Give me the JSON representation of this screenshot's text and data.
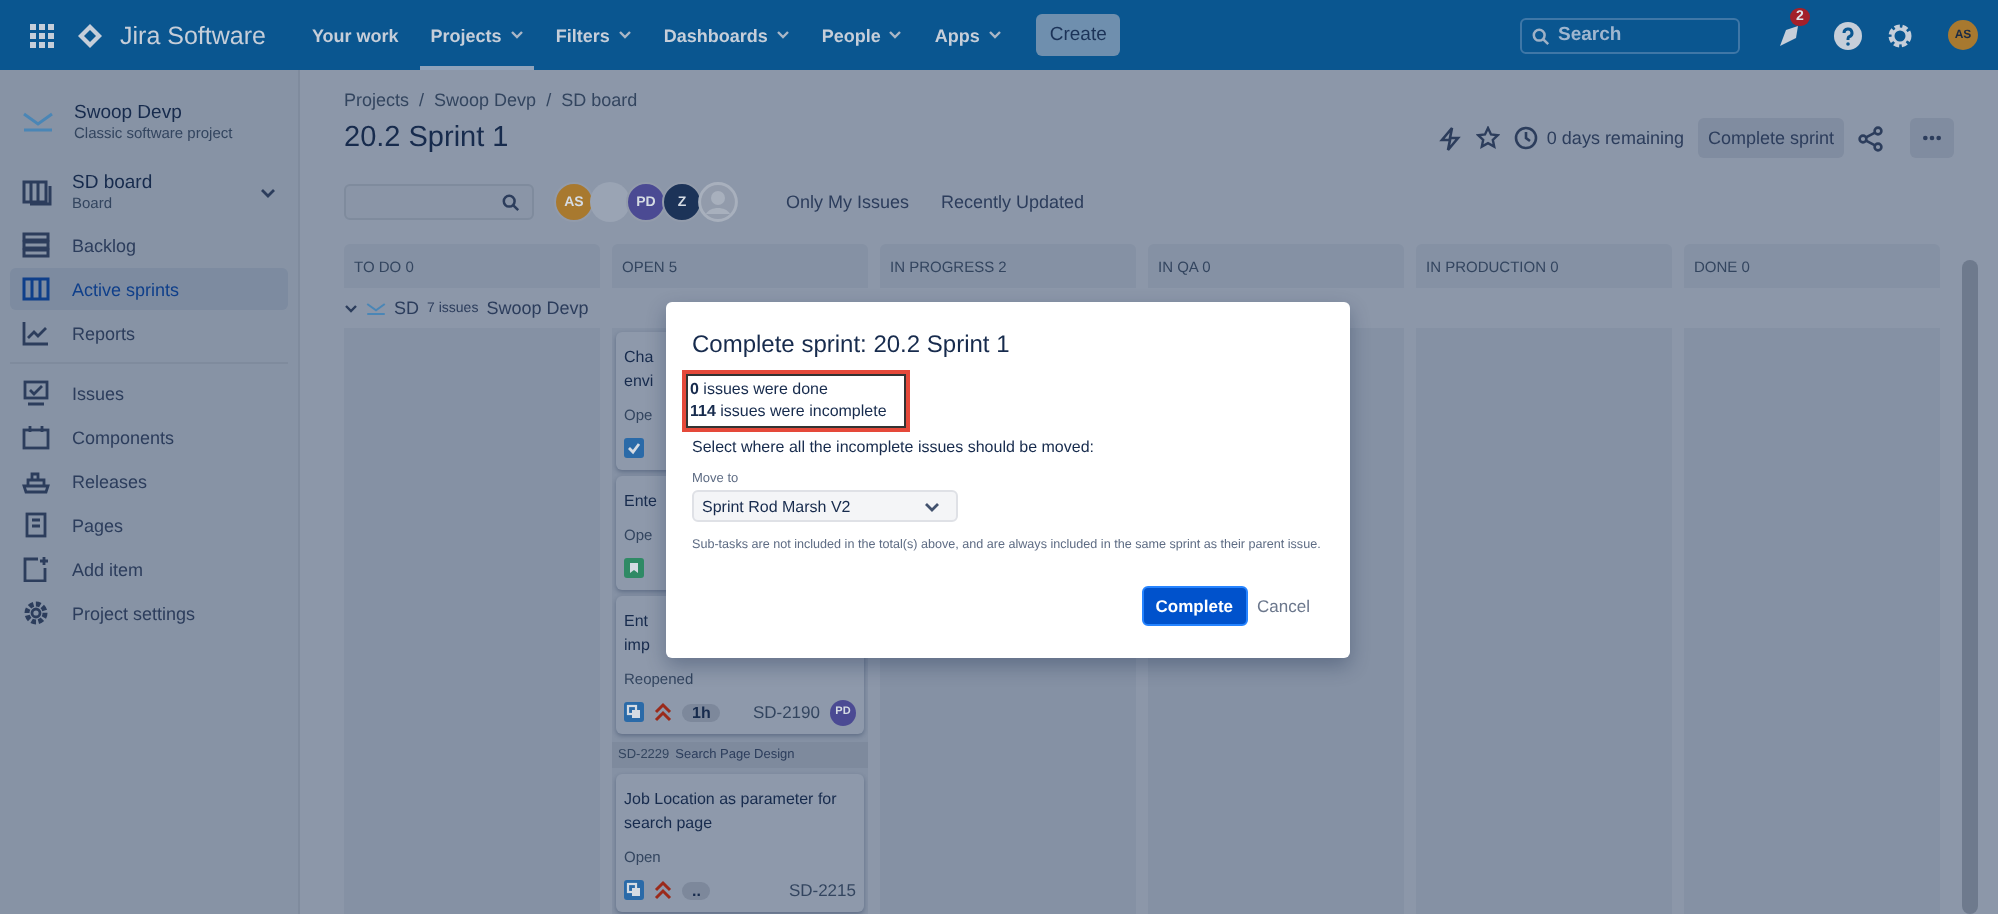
{
  "topnav": {
    "product": "Jira Software",
    "items": [
      {
        "label": "Your work",
        "dropdown": false,
        "selected": false
      },
      {
        "label": "Projects",
        "dropdown": true,
        "selected": true
      },
      {
        "label": "Filters",
        "dropdown": true,
        "selected": false
      },
      {
        "label": "Dashboards",
        "dropdown": true,
        "selected": false
      },
      {
        "label": "People",
        "dropdown": true,
        "selected": false
      },
      {
        "label": "Apps",
        "dropdown": true,
        "selected": false
      }
    ],
    "create": "Create",
    "search": {
      "placeholder": "Search"
    },
    "notification_count": "2",
    "avatar": "AS"
  },
  "sidebar": {
    "project": {
      "name": "Swoop Devp",
      "type": "Classic software project"
    },
    "board": {
      "name": "SD board",
      "type": "Board"
    },
    "items": [
      {
        "kind": "backlog",
        "label": "Backlog",
        "selected": false
      },
      {
        "kind": "sprints",
        "label": "Active sprints",
        "selected": true
      },
      {
        "kind": "reports",
        "label": "Reports",
        "selected": false
      }
    ],
    "more_items": [
      {
        "kind": "issues",
        "label": "Issues",
        "selected": false
      },
      {
        "kind": "components",
        "label": "Components",
        "selected": false
      },
      {
        "kind": "releases",
        "label": "Releases",
        "selected": false
      },
      {
        "kind": "pages",
        "label": "Pages",
        "selected": false
      },
      {
        "kind": "add",
        "label": "Add item",
        "selected": false
      },
      {
        "kind": "settings",
        "label": "Project settings",
        "selected": false
      }
    ]
  },
  "breadcrumbs": [
    {
      "label": "Projects"
    },
    {
      "separator": "/",
      "label": "Swoop Devp"
    },
    {
      "separator": "/",
      "label": "SD board"
    }
  ],
  "title": "20.2 Sprint 1",
  "header_actions": {
    "remaining": "0 days remaining",
    "complete": "Complete sprint"
  },
  "avatars": [
    {
      "kind": "initials",
      "initials": "AS",
      "color": "#a8792f"
    },
    {
      "kind": "photo"
    },
    {
      "kind": "initials",
      "initials": "PD",
      "color": "#4b4a93"
    },
    {
      "kind": "initials",
      "initials": "Z",
      "color": "#1c3358"
    },
    {
      "kind": "default"
    }
  ],
  "quick_filters": [
    "Only My Issues",
    "Recently Updated"
  ],
  "columns": [
    {
      "name": "TO DO",
      "count": "0"
    },
    {
      "name": "OPEN",
      "count": "5"
    },
    {
      "name": "IN PROGRESS",
      "count": "2"
    },
    {
      "name": "IN QA",
      "count": "0"
    },
    {
      "name": "IN PRODUCTION",
      "count": "0"
    },
    {
      "name": "DONE",
      "count": "0"
    }
  ],
  "swimlane": {
    "key": "SD",
    "count": "7 issues",
    "name": "Swoop Devp"
  },
  "cards": [
    {
      "kind": "task",
      "lines": [
        "Cha",
        "envi"
      ],
      "status": "Ope"
    },
    {
      "kind": "story",
      "lines": [
        "Ente"
      ],
      "status": "Ope"
    },
    {
      "kind": "subtask",
      "lines": [
        "Ent",
        "imp"
      ],
      "status": "Reopened",
      "priority": true,
      "estimate": "1h",
      "key": "SD-2190",
      "assignee": "PD"
    },
    {
      "kind": "parent",
      "key": "SD-2229",
      "summary": "Search Page Design"
    },
    {
      "kind": "subtask",
      "lines": [
        "Job Location as parameter for",
        "search page"
      ],
      "status": "Open",
      "priority": true,
      "estimate": "..",
      "key": "SD-2215"
    },
    {
      "kind": "blank"
    }
  ],
  "modal": {
    "title": "Complete sprint: 20.2 Sprint 1",
    "counts": [
      "**0** issues were done",
      "**114** issues were incomplete"
    ],
    "prompt": "Select where all the incomplete issues should be moved:",
    "move_label": "Move to",
    "move_value": "Sprint Rod Marsh V2",
    "note": "Sub-tasks are not included in the total(s) above, and are always included in the same sprint as their parent issue.",
    "primary": "Complete",
    "cancel": "Cancel"
  }
}
